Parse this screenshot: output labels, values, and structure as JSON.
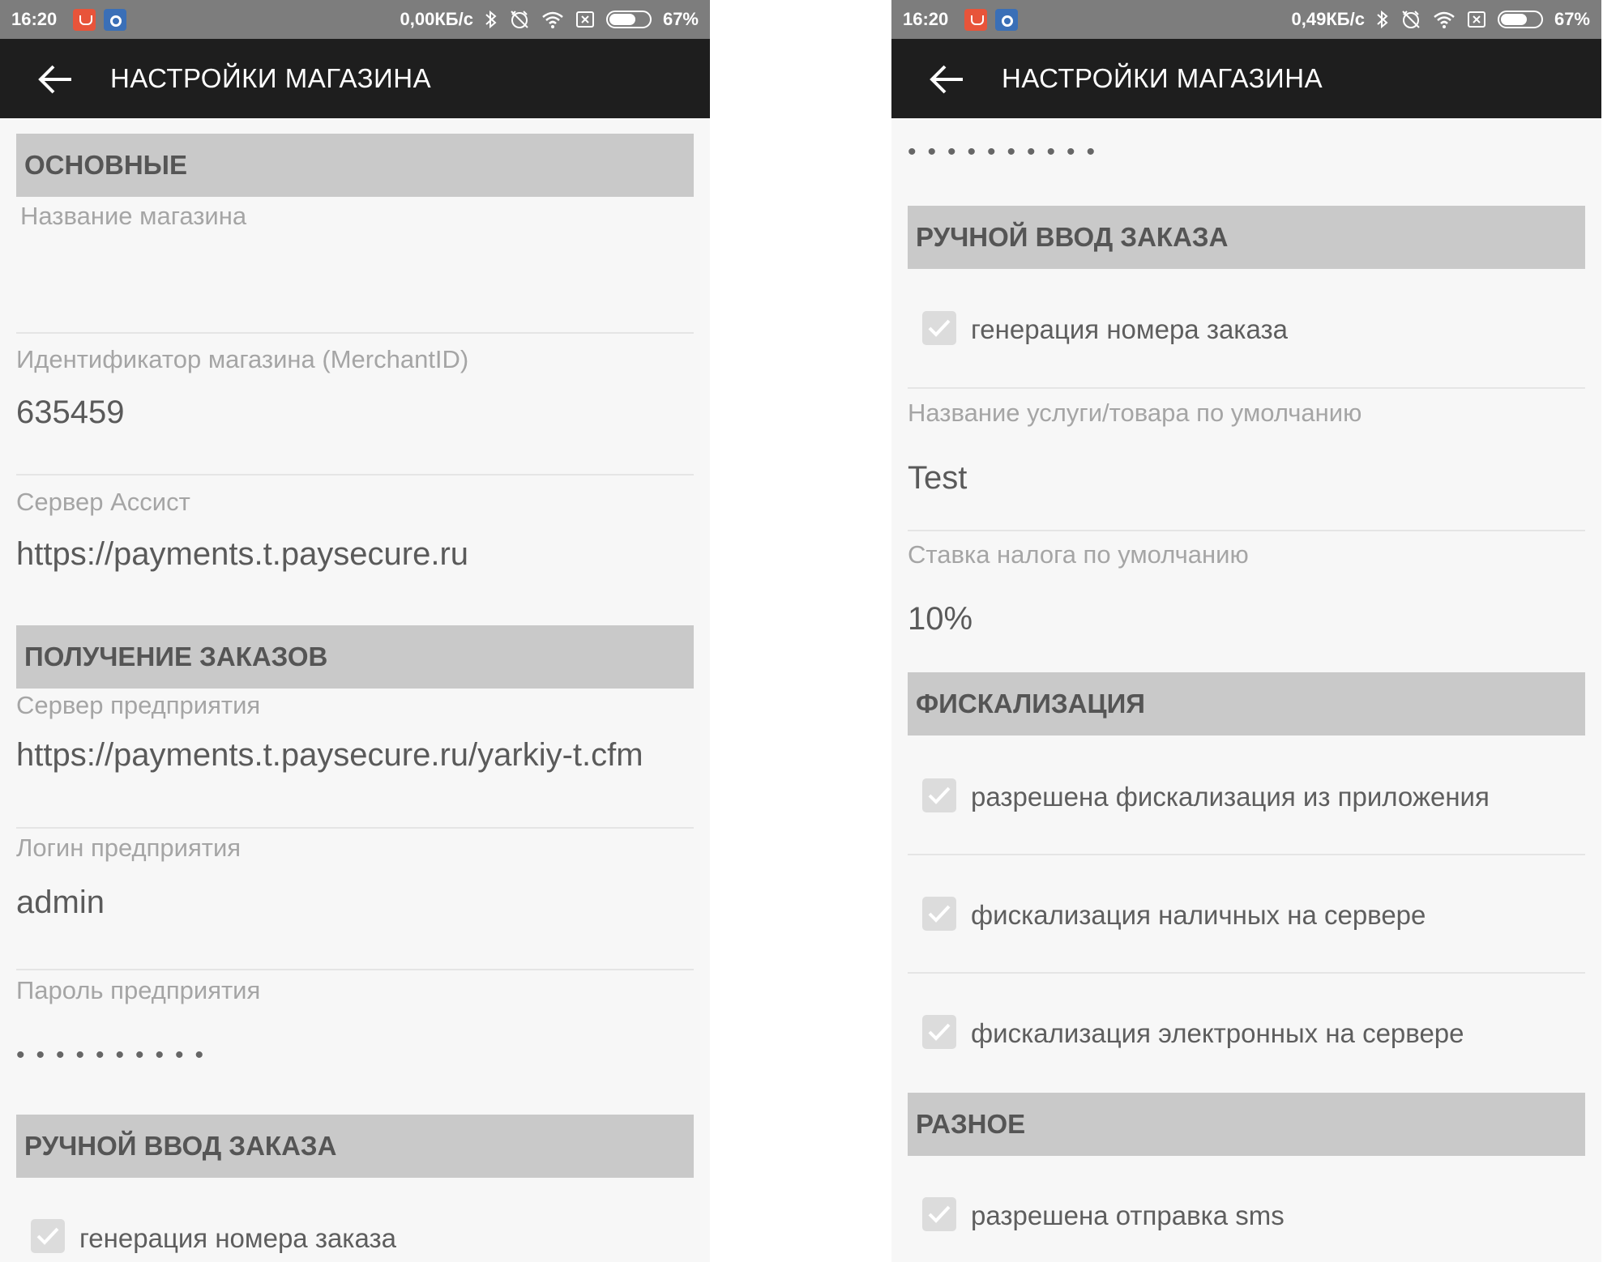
{
  "left": {
    "status": {
      "time": "16:20",
      "speed": "0,00КБ/с",
      "battery": "67%"
    },
    "appbar": {
      "title": "НАСТРОЙКИ МАГАЗИНА"
    },
    "sections": {
      "main": "ОСНОВНЫЕ",
      "orders": "ПОЛУЧЕНИЕ ЗАКАЗОВ",
      "manual": "РУЧНОЙ ВВОД ЗАКАЗА"
    },
    "fields": {
      "store_name_label": "Название магазина",
      "store_name_value": "",
      "merchant_label": "Идентификатор магазина (MerchantID)",
      "merchant_value": "635459",
      "server_label": "Сервер Ассист",
      "server_value": "https://payments.t.paysecure.ru",
      "ent_server_label": "Сервер предприятия",
      "ent_server_value": "https://payments.t.paysecure.ru/yarkiy-t.cfm",
      "login_label": "Логин предприятия",
      "login_value": "admin",
      "password_label": "Пароль предприятия",
      "password_value": "••••••••••"
    },
    "checks": {
      "order_number": "генерация номера заказа"
    }
  },
  "right": {
    "status": {
      "time": "16:20",
      "speed": "0,49КБ/с",
      "battery": "67%"
    },
    "appbar": {
      "title": "НАСТРОЙКИ МАГАЗИНА"
    },
    "password_value": "••••••••••",
    "sections": {
      "manual": "РУЧНОЙ ВВОД ЗАКАЗА",
      "fiscal": "ФИСКАЛИЗАЦИЯ",
      "misc": "РАЗНОЕ"
    },
    "checks": {
      "order_number": "генерация номера заказа",
      "fiscal_app": "разрешена фискализация из приложения",
      "fiscal_cash": "фискализация наличных на сервере",
      "fiscal_electronic": "фискализация электронных на сервере",
      "sms": "разрешена отправка sms"
    },
    "fields": {
      "default_service_label": "Название услуги/товара по умолчанию",
      "default_service_value": "Test",
      "tax_label": "Ставка налога по умолчанию",
      "tax_value": "10%"
    }
  },
  "icons": [
    "back-arrow-icon",
    "bluetooth-icon",
    "alarm-off-icon",
    "wifi-icon",
    "sim-off-icon",
    "battery-icon",
    "check-icon"
  ],
  "colors": {
    "statusbar": "#7d7d7d",
    "appbar": "#1e1e1e",
    "section": "#c9c9c9",
    "background": "#f7f7f7"
  }
}
